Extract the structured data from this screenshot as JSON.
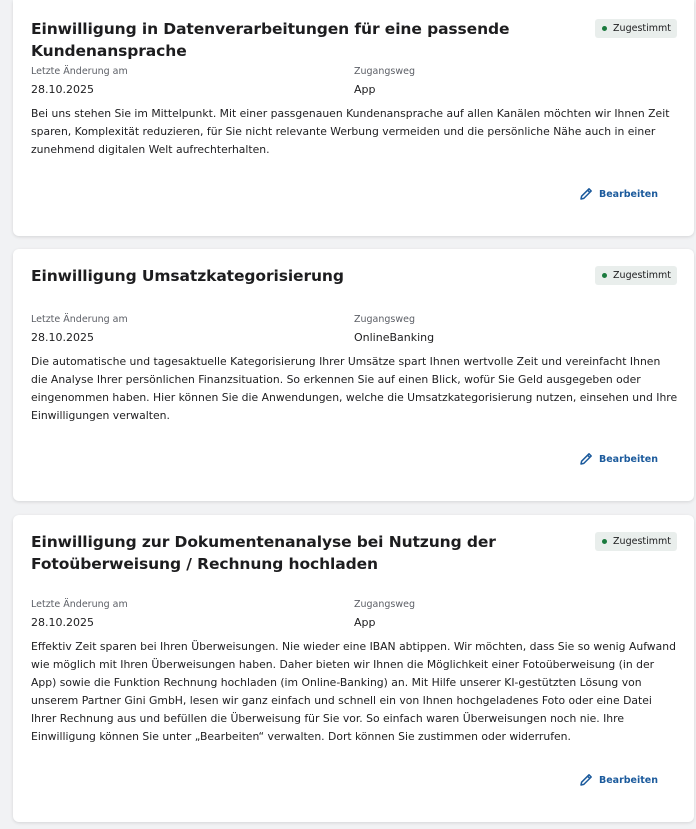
{
  "labels": {
    "last_change": "Letzte Änderung am",
    "access": "Zugangsweg",
    "edit": "Bearbeiten"
  },
  "colors": {
    "accent": "#1b5a9c",
    "status_green": "#1b7a3e",
    "badge_bg": "#e9eeec"
  },
  "cards": [
    {
      "title": "Einwilligung in Datenverarbeitungen für eine passende Kundenansprache",
      "status": "Zugestimmt",
      "last_change_date": "28.10.2025",
      "access_value": "App",
      "description": "Bei uns stehen Sie im Mittelpunkt. Mit einer passgenauen Kundenansprache auf allen Kanälen möchten wir Ihnen Zeit sparen, Komplexität reduzieren, für Sie nicht relevante Werbung vermeiden und die persönliche Nähe auch in einer zunehmend digitalen Welt aufrechterhalten."
    },
    {
      "title": "Einwilligung Umsatzkategorisierung",
      "status": "Zugestimmt",
      "last_change_date": "28.10.2025",
      "access_value": "OnlineBanking",
      "description": "Die automatische und tagesaktuelle Kategorisierung Ihrer Umsätze spart Ihnen wertvolle Zeit und vereinfacht Ihnen die Analyse Ihrer persönlichen Finanzsituation. So erkennen Sie auf einen Blick, wofür Sie Geld ausgegeben oder eingenommen haben. Hier können Sie die Anwendungen, welche die Umsatzkategorisierung nutzen, einsehen und Ihre Einwilligungen verwalten."
    },
    {
      "title": "Einwilligung zur Dokumentenanalyse bei Nutzung der Fotoüberweisung / Rechnung hochladen",
      "status": "Zugestimmt",
      "last_change_date": "28.10.2025",
      "access_value": "App",
      "description": "Effektiv Zeit sparen bei Ihren Überweisungen. Nie wieder eine IBAN abtippen. Wir möchten, dass Sie so wenig Aufwand wie möglich mit Ihren Überweisungen haben. Daher bieten wir Ihnen die Möglichkeit einer Fotoüberweisung (in der App) sowie die Funktion Rechnung hochladen (im Online-Banking) an. Mit Hilfe unserer KI-gestützten Lösung von unserem Partner Gini GmbH, lesen wir ganz einfach und schnell ein von Ihnen hochgeladenes Foto oder eine Datei Ihrer Rechnung aus und befüllen die Überweisung für Sie vor. So einfach waren Überweisungen noch nie. Ihre Einwilligung können Sie unter „Bearbeiten“ verwalten. Dort können Sie zustimmen oder widerrufen."
    }
  ]
}
